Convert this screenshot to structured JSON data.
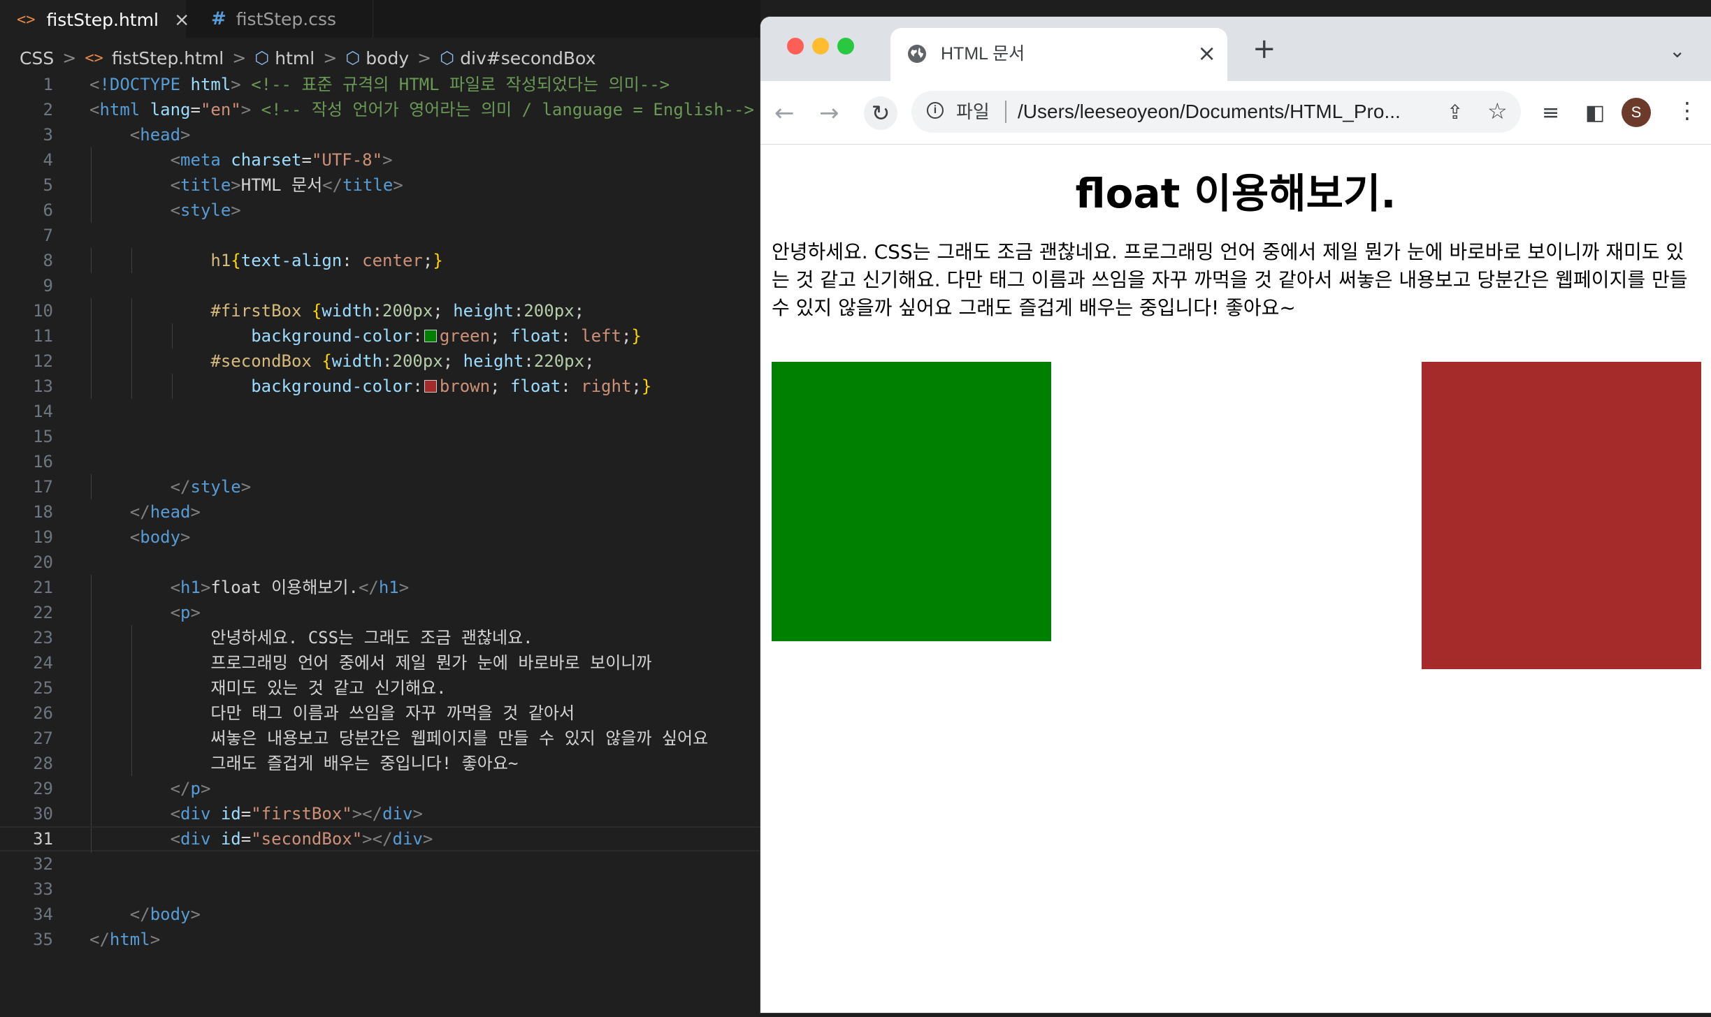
{
  "editor": {
    "tabs": [
      {
        "name": "fistStep.html",
        "active": true
      },
      {
        "name": "fistStep.css",
        "active": false
      }
    ],
    "breadcrumb": [
      "CSS",
      "fistStep.html",
      "html",
      "body",
      "div#secondBox"
    ],
    "current_line": 31,
    "lines": [
      "<!DOCTYPE html> <!-- 표준 규격의 HTML 파일로 작성되었다는 의미-->",
      "<html lang=\"en\"> <!-- 작성 언어가 영어라는 의미 / language = English-->",
      "    <head>",
      "        <meta charset=\"UTF-8\">",
      "        <title>HTML 문서</title>",
      "        <style>",
      "",
      "            h1{text-align: center;}",
      "",
      "            #firstBox {width:200px; height:200px;",
      "                background-color:green; float: left;}",
      "            #secondBox {width:200px; height:220px;",
      "                background-color:brown; float: right;}",
      "",
      "",
      "",
      "        </style>",
      "    </head>",
      "    <body>",
      "",
      "        <h1>float 이용해보기.</h1>",
      "        <p>",
      "            안녕하세요. CSS는 그래도 조금 괜찮네요.",
      "            프로그래밍 언어 중에서 제일 뭔가 눈에 바로바로 보이니까",
      "            재미도 있는 것 같고 신기해요.",
      "            다만 태그 이름과 쓰임을 자꾸 까먹을 것 같아서",
      "            써놓은 내용보고 당분간은 웹페이지를 만들 수 있지 않을까 싶어요",
      "            그래도 즐겁게 배우는 중입니다! 좋아요~",
      "        </p>",
      "        <div id=\"firstBox\"></div>",
      "        <div id=\"secondBox\"></div>",
      "",
      "",
      "    </body>",
      "</html>"
    ]
  },
  "browser": {
    "tab_title": "HTML 문서",
    "scheme_label": "파일",
    "url": "/Users/leeseoyeon/Documents/HTML_Pro...",
    "avatar_letter": "S",
    "page": {
      "h1": "float 이용해보기.",
      "paragraph": "안녕하세요. CSS는 그래도 조금 괜찮네요. 프로그래밍 언어 중에서 제일 뭔가 눈에 바로바로 보이니까 재미도 있는 것 같고 신기해요. 다만 태그 이름과 쓰임을 자꾸 까먹을 것 같아서 써놓은 내용보고 당분간은 웹페이지를 만들 수 있지 않을까 싶어요 그래도 즐겁게 배우는 중입니다! 좋아요~",
      "first_box_color": "green",
      "second_box_color": "brown"
    }
  },
  "colors": {
    "editor_bg": "#1f1f1f",
    "tag": "#569cd6",
    "attribute": "#9cdcfe",
    "string": "#ce9178",
    "comment": "#6a9955",
    "selector": "#d7ba7d"
  }
}
